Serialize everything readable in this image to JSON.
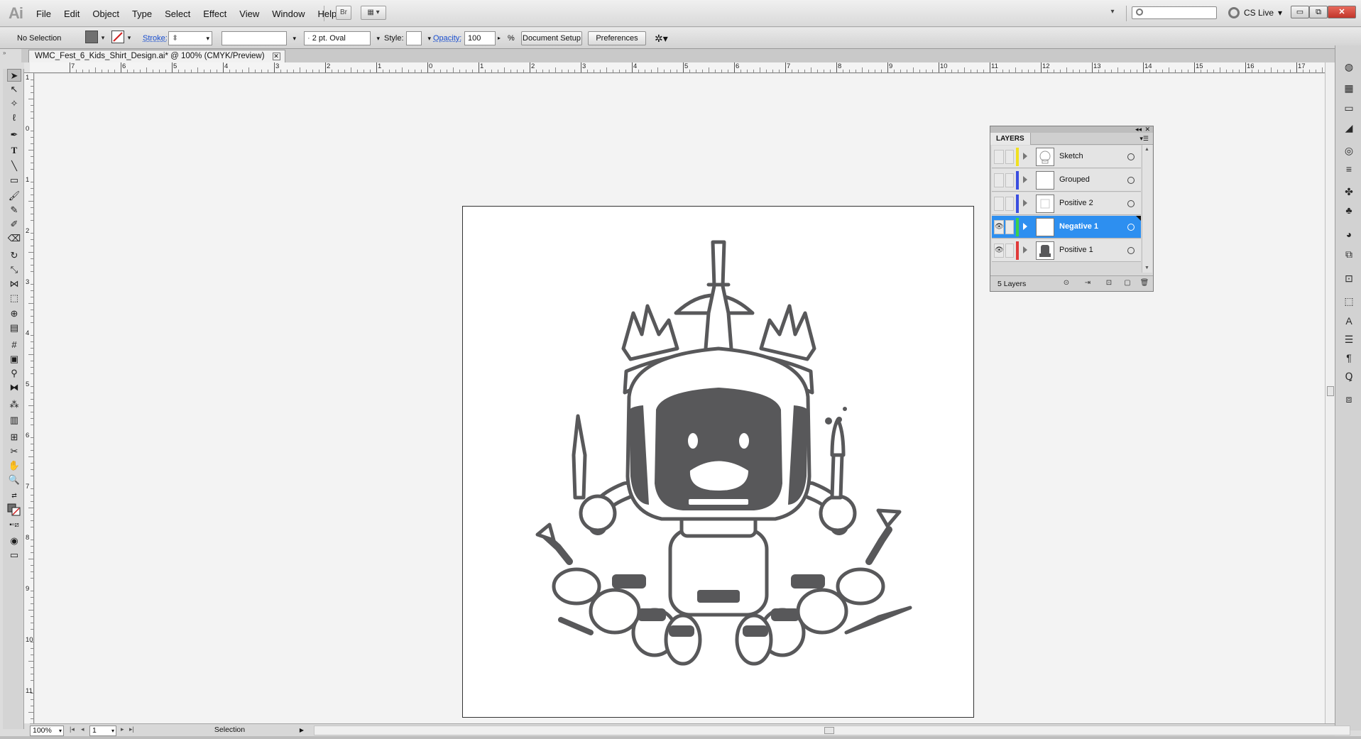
{
  "app": {
    "logo": "Ai",
    "menus": [
      "File",
      "Edit",
      "Object",
      "Type",
      "Select",
      "Effect",
      "View",
      "Window",
      "Help"
    ],
    "bridge_label": "Br",
    "cs_live": "CS Live"
  },
  "control_bar": {
    "selection_state": "No Selection",
    "stroke_label": "Stroke:",
    "brush_value": "2 pt. Oval",
    "style_label": "Style:",
    "opacity_label": "Opacity:",
    "opacity_value": "100",
    "opacity_unit": "%",
    "document_setup": "Document Setup",
    "preferences": "Preferences",
    "fill_color": "#707070"
  },
  "document": {
    "tab_title": "WMC_Fest_6_Kids_Shirt_Design.ai* @ 100% (CMYK/Preview)"
  },
  "ruler": {
    "top_labels": [
      "7",
      "6",
      "5",
      "4",
      "3",
      "2",
      "1",
      "0",
      "1",
      "2",
      "3",
      "4",
      "5",
      "6",
      "7",
      "8",
      "9",
      "10",
      "11",
      "12",
      "13",
      "14",
      "15",
      "16",
      "17"
    ],
    "left_labels": [
      "1",
      "0",
      "1",
      "2",
      "3",
      "4",
      "5",
      "6",
      "7",
      "8",
      "9",
      "10",
      "11"
    ]
  },
  "layers_panel": {
    "title": "LAYERS",
    "count_label": "5 Layers",
    "layers": [
      {
        "name": "Sketch",
        "visible": false,
        "color": "#f0e020"
      },
      {
        "name": "Grouped",
        "visible": false,
        "color": "#3a4ee0"
      },
      {
        "name": "Positive 2",
        "visible": false,
        "color": "#3a4ee0"
      },
      {
        "name": "Negative 1",
        "visible": true,
        "color": "#3bd04a",
        "selected": true
      },
      {
        "name": "Positive 1",
        "visible": true,
        "color": "#e03a3a"
      }
    ]
  },
  "status_bar": {
    "zoom": "100%",
    "artboard_number": "1",
    "tool_name": "Selection"
  },
  "artwork": {
    "ink_color": "#58585a"
  }
}
